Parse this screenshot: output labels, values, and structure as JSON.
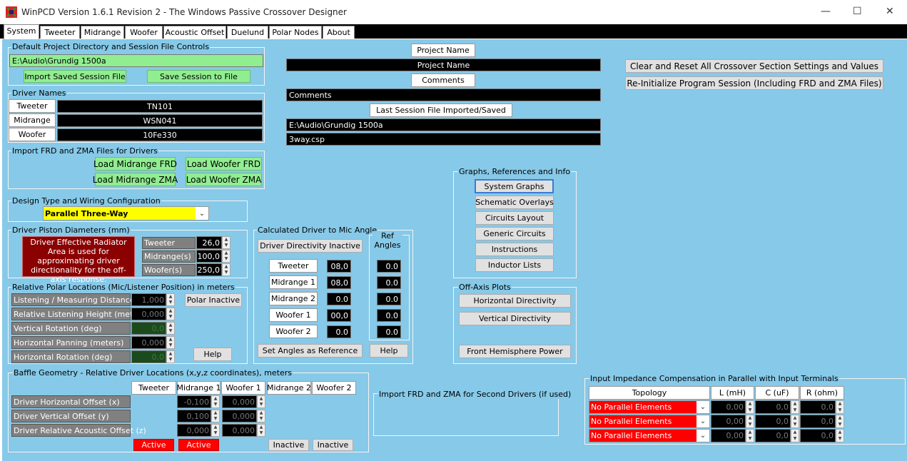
{
  "window": {
    "title": "WinPCD Version 1.6.1 Revision 2 - The Windows Passive Crossover Designer",
    "minimize": "—",
    "maximize": "☐",
    "close": "✕"
  },
  "tabs": [
    "System",
    "Tweeter",
    "Midrange",
    "Woofer",
    "Acoustic Offset",
    "Duelund",
    "Polar Nodes",
    "About"
  ],
  "project_group": {
    "title": "Default Project Directory and Session File Controls",
    "path": "E:\\Audio\\Grundig 1500a",
    "import_btn": "Import Saved Session File",
    "save_btn": "Save Session to File"
  },
  "project_fields": {
    "name_label": "Project Name",
    "name_value": "Project Name",
    "comments_label": "Comments",
    "comments_value": "Comments",
    "last_session_label": "Last Session File Imported/Saved",
    "last_session_path": "E:\\Audio\\Grundig 1500a",
    "last_session_file": "3way.csp"
  },
  "reset_buttons": {
    "clear": "Clear and Reset All Crossover Section Settings and Values",
    "reinit": "Re-Initialize Program Session (Including FRD and ZMA Files)"
  },
  "driver_names": {
    "title": "Driver Names",
    "rows": [
      {
        "label": "Tweeter",
        "value": "TN101"
      },
      {
        "label": "Midrange",
        "value": "WSN041"
      },
      {
        "label": "Woofer",
        "value": "10Fe330"
      }
    ]
  },
  "import_frd": {
    "title": "Import FRD and ZMA Files for Drivers",
    "mid_frd": "Load Midrange FRD",
    "woof_frd": "Load Woofer FRD",
    "mid_zma": "Load Midrange ZMA",
    "woof_zma": "Load Woofer ZMA"
  },
  "design_type": {
    "title": "Design Type and Wiring Configuration",
    "value": "Parallel  Three-Way"
  },
  "piston": {
    "title": "Driver Piston Diameters (mm)",
    "note": "Driver Effective Radiator Area is used for approximating driver directionality for the off-axis response.",
    "rows": [
      {
        "label": "Tweeter",
        "value": "26,0"
      },
      {
        "label": "Midrange(s)",
        "value": "100,0"
      },
      {
        "label": "Woofer(s)",
        "value": "250,0"
      }
    ]
  },
  "polar": {
    "title": "Relative Polar Locations  (Mic/Listener Position) in meters",
    "rows": [
      {
        "label": "Listening / Measuring Distance",
        "value": "1,000"
      },
      {
        "label": "Relative Listening Height (meters)",
        "value": "0,000"
      },
      {
        "label": "Vertical Rotation (deg)",
        "value": "0,0"
      },
      {
        "label": "Horizontal Panning (meters)",
        "value": "0,000"
      },
      {
        "label": "Horizontal Rotation (deg)",
        "value": "0,0"
      }
    ],
    "inactive_btn": "Polar Inactive",
    "help_btn": "Help"
  },
  "mic_angle": {
    "title": "Calculated Driver to Mic Angle",
    "directivity_btn": "Driver Directivity Inactive",
    "ref_title": "Ref Angles",
    "rows": [
      {
        "label": "Tweeter",
        "value": "08,0",
        "ref": "0.0"
      },
      {
        "label": "Midrange 1",
        "value": "08,0",
        "ref": "0.0"
      },
      {
        "label": "Midrange 2",
        "value": "0.0",
        "ref": "0.0"
      },
      {
        "label": "Woofer 1",
        "value": "00,0",
        "ref": "0.0"
      },
      {
        "label": "Woofer 2",
        "value": "0.0",
        "ref": "0.0"
      }
    ],
    "set_ref_btn": "Set Angles as Reference",
    "help_btn": "Help"
  },
  "graphs": {
    "title": "Graphs, References and Info",
    "buttons": [
      "System Graphs",
      "Schematic Overlays",
      "Circuits Layout",
      "Generic Circuits",
      "Instructions",
      "Inductor Lists"
    ]
  },
  "offaxis": {
    "title": "Off-Axis Plots",
    "horizontal": "Horizontal Directivity",
    "vertical": "Vertical Directivity",
    "front": "Front Hemisphere Power"
  },
  "baffle": {
    "title": "Baffle Geometry - Relative Driver Locations (x,y,z coordinates), meters",
    "headers": [
      "Tweeter",
      "Midrange 1",
      "Woofer 1",
      "Midrange 2",
      "Woofer 2"
    ],
    "rows": [
      {
        "label": "Driver Horizontal Offset (x)",
        "mid1": "-0,100",
        "woof1": "0,000"
      },
      {
        "label": "Driver Vertical Offset (y)",
        "mid1": "0,100",
        "woof1": "0,000"
      },
      {
        "label": "Driver Relative Acoustic Offset (z)",
        "mid1": "0,000",
        "woof1": "0,000"
      }
    ],
    "states": [
      "Active",
      "Active",
      "Inactive",
      "Inactive"
    ]
  },
  "second_drivers": {
    "title": "Import FRD and ZMA for Second Drivers (if used)"
  },
  "impedance": {
    "title": "Input Impedance Compensation in Parallel with Input Terminals",
    "headers": [
      "Topology",
      "L (mH)",
      "C (uF)",
      "R (ohm)"
    ],
    "rows": [
      {
        "topology": "No Parallel Elements",
        "l": "0,00",
        "c": "0,0",
        "r": "0,0"
      },
      {
        "topology": "No Parallel Elements",
        "l": "0,00",
        "c": "0,0",
        "r": "0,0"
      },
      {
        "topology": "No Parallel Elements",
        "l": "0,00",
        "c": "0,0",
        "r": "0,0"
      }
    ]
  }
}
